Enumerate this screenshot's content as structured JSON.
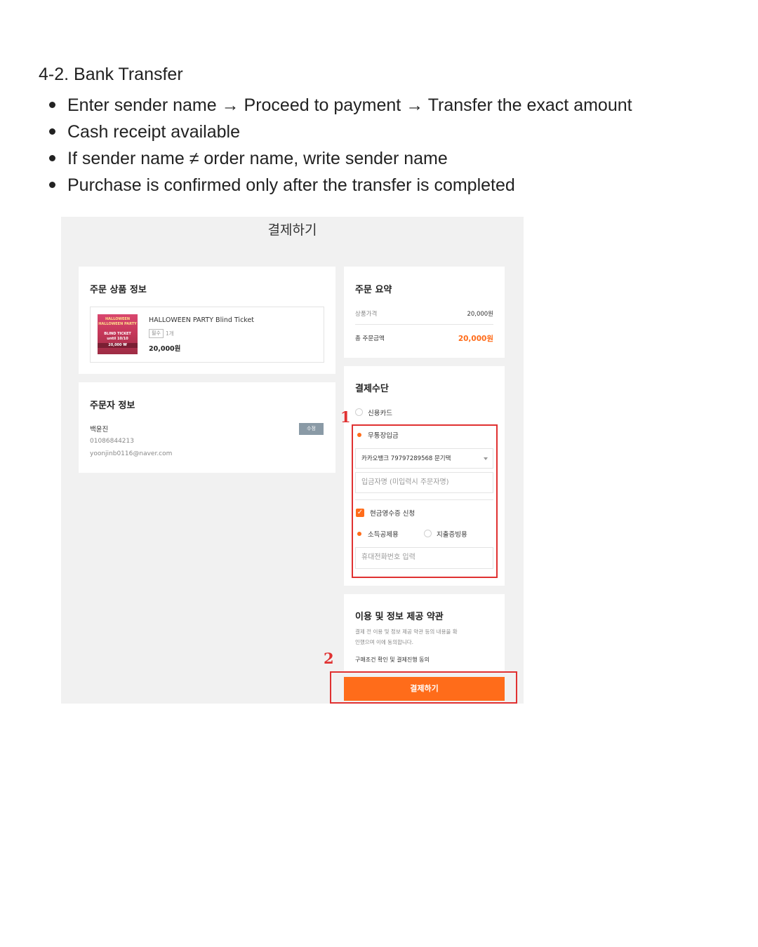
{
  "doc": {
    "heading": "4-2. Bank Transfer",
    "bullets": [
      "Enter sender name → Proceed to payment → Transfer the exact amount",
      "Cash receipt available",
      "If sender name ≠ order name, write sender name",
      "Purchase is confirmed only after the transfer is completed"
    ]
  },
  "checkout": {
    "title": "결제하기",
    "product_info": {
      "title": "주문 상품 정보",
      "thumbnail_text": [
        "HALLOWEEN",
        "HALLOWEEN PARTY",
        "BLIND TICKET",
        "until 10/10",
        "20,000 ₩"
      ],
      "name": "HALLOWEEN PARTY Blind Ticket",
      "badge": "필수",
      "qty": "1개",
      "price": "20,000원"
    },
    "orderer": {
      "title": "주문자 정보",
      "name": "백윤진",
      "phone": "01086844213",
      "email": "yoonjinb0116@naver.com",
      "edit_label": "수정"
    },
    "summary": {
      "title": "주문 요약",
      "price_label": "상품가격",
      "price_value": "20,000원",
      "total_label": "총 주문금액",
      "total_value": "20,000원"
    },
    "payment": {
      "title": "결제수단",
      "credit_label": "신용카드",
      "bank_label": "무통장입금",
      "bank_account": "카카오뱅크 79797289568 문기택",
      "depositor_placeholder": "입금자명 (미입력시 주문자명)",
      "cash_receipt_label": "현금영수증 신청",
      "income_deduction_label": "소득공제용",
      "expense_proof_label": "지출증빙용",
      "phone_placeholder": "휴대전화번호 입력"
    },
    "terms": {
      "title": "이용 및 정보 제공 약관",
      "description_line1": "결제 전 이용 및 정보 제공 약관 등의 내용을 확",
      "description_line2": "인했으며 이에 동의합니다.",
      "agree_label": "구매조건 확인 및 결제진행 동의"
    },
    "pay_button": "결제하기",
    "annotations": [
      "1",
      "2"
    ],
    "colors": {
      "accent": "#ff6c1a",
      "annotation": "#e03131"
    }
  }
}
